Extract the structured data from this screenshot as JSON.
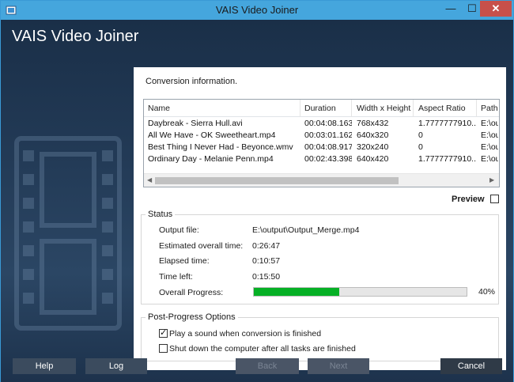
{
  "window": {
    "title": "VAIS Video Joiner",
    "heading": "VAIS Video Joiner",
    "controls": {
      "minimize": "—",
      "maximize": "☐",
      "close": "✕"
    }
  },
  "conversion": {
    "label": "Conversion information.",
    "columns": [
      "Name",
      "Duration",
      "Width x Height",
      "Aspect Ratio",
      "Path"
    ],
    "rows": [
      [
        "Daybreak - Sierra Hull.avi",
        "00:04:08.163",
        "768x432",
        "1.7777777910...",
        "E:\\ou"
      ],
      [
        "All We Have - OK Sweetheart.mp4",
        "00:03:01.162",
        "640x320",
        "0",
        "E:\\ou"
      ],
      [
        "Best Thing I Never Had - Beyonce.wmv",
        "00:04:08.917",
        "320x240",
        "0",
        "E:\\ou"
      ],
      [
        "Ordinary Day - Melanie Penn.mp4",
        "00:02:43.398",
        "640x420",
        "1.7777777910...",
        "E:\\ou"
      ]
    ]
  },
  "preview": {
    "label": "Preview",
    "checked": false
  },
  "status": {
    "title": "Status",
    "output_file_label": "Output file:",
    "output_file_value": "E:\\output\\Output_Merge.mp4",
    "estimated_label": "Estimated overall time:",
    "estimated_value": "0:26:47",
    "elapsed_label": "Elapsed time:",
    "elapsed_value": "0:10:57",
    "left_label": "Time left:",
    "left_value": "0:15:50",
    "progress_label": "Overall Progress:",
    "progress_value": 40,
    "progress_text": "40%"
  },
  "post_options": {
    "title": "Post-Progress Options",
    "play_sound_label": "Play a sound when conversion is finished",
    "play_sound_checked": true,
    "shutdown_label": "Shut down the computer after all tasks are finished",
    "shutdown_checked": false
  },
  "buttons": {
    "help": "Help",
    "log": "Log",
    "back": "Back",
    "next": "Next",
    "cancel": "Cancel"
  },
  "colors": {
    "titlebar": "#45a6dd",
    "progress": "#06b025",
    "close": "#c7504a"
  }
}
